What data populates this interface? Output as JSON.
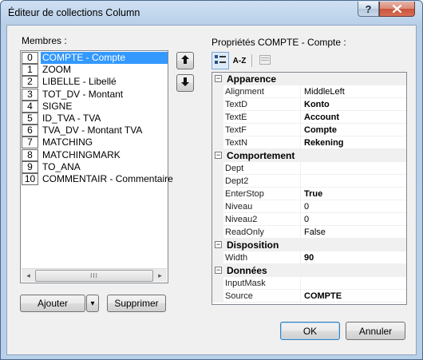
{
  "window": {
    "title": "Éditeur de collections Column",
    "help_icon": "?",
    "close_icon": "X"
  },
  "members": {
    "label": "Membres :",
    "items": [
      {
        "index": "0",
        "text": "COMPTE - Compte",
        "selected": true
      },
      {
        "index": "1",
        "text": "ZOOM"
      },
      {
        "index": "2",
        "text": "LIBELLE - Libellé"
      },
      {
        "index": "3",
        "text": "TOT_DV - Montant"
      },
      {
        "index": "4",
        "text": "SIGNE"
      },
      {
        "index": "5",
        "text": "ID_TVA - TVA"
      },
      {
        "index": "6",
        "text": "TVA_DV - Montant TVA"
      },
      {
        "index": "7",
        "text": "MATCHING"
      },
      {
        "index": "8",
        "text": "MATCHINGMARK"
      },
      {
        "index": "9",
        "text": "TO_ANA"
      },
      {
        "index": "10",
        "text": "COMMENTAIR - Commentaire"
      }
    ],
    "scroll_thumb_grip": "III",
    "scroll_left_icon": "◂",
    "scroll_right_icon": "▸"
  },
  "buttons": {
    "move_up_icon": "arrow-up-icon",
    "move_down_icon": "arrow-down-icon",
    "add": "Ajouter",
    "add_dropdown_icon": "▾",
    "remove": "Supprimer",
    "ok": "OK",
    "cancel": "Annuler"
  },
  "properties": {
    "label": "Propriétés COMPTE - Compte :",
    "toolbar": {
      "categorized_icon": "categorized-icon",
      "alphabetical_icon": "A-Z",
      "pages_icon": "property-pages-icon"
    },
    "categories": [
      {
        "name": "Apparence",
        "toggle": "−",
        "props": [
          {
            "name": "Alignment",
            "value": "MiddleLeft",
            "bold": false
          },
          {
            "name": "TextD",
            "value": "Konto",
            "bold": true
          },
          {
            "name": "TextE",
            "value": "Account",
            "bold": true
          },
          {
            "name": "TextF",
            "value": "Compte",
            "bold": true
          },
          {
            "name": "TextN",
            "value": "Rekening",
            "bold": true
          }
        ]
      },
      {
        "name": "Comportement",
        "toggle": "−",
        "props": [
          {
            "name": "Dept",
            "value": "",
            "bold": false
          },
          {
            "name": "Dept2",
            "value": "",
            "bold": false
          },
          {
            "name": "EnterStop",
            "value": "True",
            "bold": true
          },
          {
            "name": "Niveau",
            "value": "0",
            "bold": false
          },
          {
            "name": "Niveau2",
            "value": "0",
            "bold": false
          },
          {
            "name": "ReadOnly",
            "value": "False",
            "bold": false
          }
        ]
      },
      {
        "name": "Disposition",
        "toggle": "−",
        "props": [
          {
            "name": "Width",
            "value": "90",
            "bold": true
          }
        ]
      },
      {
        "name": "Données",
        "toggle": "−",
        "props": [
          {
            "name": "InputMask",
            "value": "",
            "bold": false
          },
          {
            "name": "Source",
            "value": "COMPTE",
            "bold": true
          }
        ]
      }
    ]
  }
}
